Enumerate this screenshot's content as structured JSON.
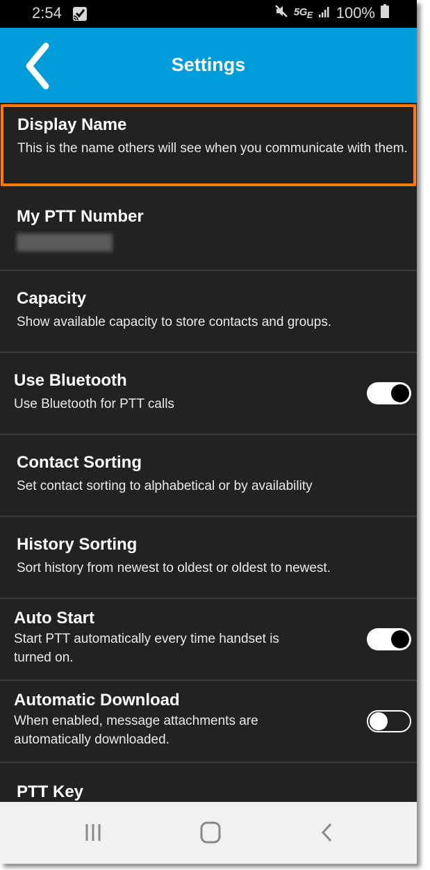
{
  "status_bar": {
    "time": "2:54",
    "network": "5G",
    "network_sub": "E",
    "battery": "100%",
    "icons": [
      "cast-icon",
      "mute-icon",
      "signal-icon",
      "battery-icon"
    ]
  },
  "app_bar": {
    "title": "Settings",
    "back_icon": "chevron-left-icon",
    "color": "#009bd9"
  },
  "highlight_color": "#ff7a00",
  "settings": [
    {
      "title": "Display Name",
      "subtitle": "This is the name others will see when you communicate with them.",
      "highlighted": true
    },
    {
      "title": "My PTT Number",
      "subtitle": "",
      "redacted": true
    },
    {
      "title": "Capacity",
      "subtitle": "Show available capacity to store contacts and groups."
    },
    {
      "title": "Use Bluetooth",
      "subtitle": "Use Bluetooth for PTT calls",
      "toggle": true,
      "enabled": true
    },
    {
      "title": "Contact Sorting",
      "subtitle": "Set contact sorting to alphabetical or by availability"
    },
    {
      "title": "History Sorting",
      "subtitle": "Sort history from newest to oldest or oldest to newest."
    },
    {
      "title": "Auto Start",
      "subtitle": "Start PTT automatically every time handset is turned on.",
      "toggle": true,
      "enabled": true
    },
    {
      "title": "Automatic Download",
      "subtitle": "When enabled, message attachments are automatically downloaded.",
      "toggle": true,
      "enabled": false
    },
    {
      "title": "PTT Key",
      "subtitle": ""
    }
  ],
  "nav_bar": {
    "buttons": [
      "recent-apps-icon",
      "home-icon",
      "back-icon"
    ]
  }
}
